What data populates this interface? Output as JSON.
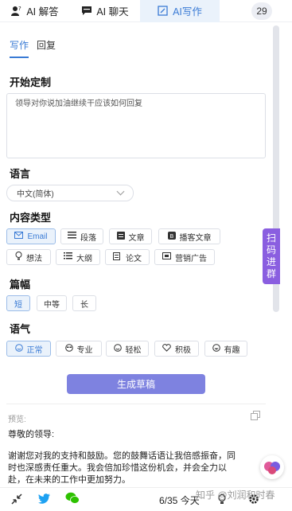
{
  "tabs": [
    {
      "label": "AI 解答",
      "icon": "person-question-icon"
    },
    {
      "label": "AI 聊天",
      "icon": "chat-icon"
    },
    {
      "label": "AI写作",
      "icon": "write-icon",
      "active": true
    }
  ],
  "badge_count": "29",
  "subtabs": [
    "写作",
    "回复"
  ],
  "sections": {
    "custom": "开始定制",
    "language": "语言",
    "content_type": "内容类型",
    "length": "篇幅",
    "tone": "语气"
  },
  "prompt_text": "领导对你说加油继续干应该如何回复",
  "language_select": "中文(简体)",
  "content_types": [
    {
      "label": "Email",
      "icon": "email-icon",
      "active": true
    },
    {
      "label": "段落",
      "icon": "paragraph-icon"
    },
    {
      "label": "文章",
      "icon": "article-icon"
    },
    {
      "label": "播客文章",
      "icon": "podcast-icon"
    },
    {
      "label": "想法",
      "icon": "bulb-icon"
    },
    {
      "label": "大纲",
      "icon": "outline-icon"
    },
    {
      "label": "论文",
      "icon": "paper-icon"
    },
    {
      "label": "营销广告",
      "icon": "ad-icon"
    }
  ],
  "lengths": [
    {
      "label": "短",
      "active": true
    },
    {
      "label": "中等"
    },
    {
      "label": "长"
    }
  ],
  "tones": [
    {
      "label": "正常",
      "icon": "smile-icon",
      "active": true
    },
    {
      "label": "专业",
      "icon": "glasses-face-icon"
    },
    {
      "label": "轻松",
      "icon": "relaxed-face-icon"
    },
    {
      "label": "积极",
      "icon": "heart-hand-icon"
    },
    {
      "label": "有趣",
      "icon": "laugh-icon"
    }
  ],
  "generate_button": "生成草稿",
  "side_button": [
    "扫",
    "码",
    "进",
    "群"
  ],
  "preview_label": "预览:",
  "preview_lines": [
    "尊敬的领导:",
    "谢谢您对我的支持和鼓励。您的鼓舞话语让我倍感振奋，同",
    "时也深感责任重大。我会倍加珍惜这份机会，并会全力以",
    "赴，在未来的工作中更加努力。"
  ],
  "counter": "6/35 今天",
  "watermark": "知乎 @刘润和时春",
  "colors": {
    "accent": "#3a7bd5",
    "button": "#7e82e0",
    "side": "#8a5ee0"
  }
}
